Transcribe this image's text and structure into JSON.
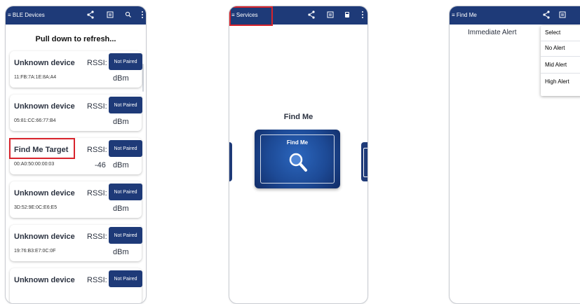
{
  "screen1": {
    "title": "BLE Devices",
    "refresh_text": "Pull down to refresh...",
    "devices": [
      {
        "name": "Unknown device",
        "rssi_label": "RSSI:",
        "pair_button": "Not Paired",
        "address": "11:FB:7A:1E:8A:A4",
        "rssi_value": "",
        "unit": "dBm"
      },
      {
        "name": "Unknown device",
        "rssi_label": "RSSI:",
        "pair_button": "Not Paired",
        "address": "05:81:CC:66:77:B4",
        "rssi_value": "",
        "unit": "dBm"
      },
      {
        "name": "Find Me Target",
        "rssi_label": "RSSI:",
        "pair_button": "Not Paired",
        "address": "00:A0:50:00:00:03",
        "rssi_value": "-46",
        "unit": "dBm"
      },
      {
        "name": "Unknown device",
        "rssi_label": "RSSI:",
        "pair_button": "Not Paired",
        "address": "3D:52:9E:0C:E6:E5",
        "rssi_value": "",
        "unit": "dBm"
      },
      {
        "name": "Unknown device",
        "rssi_label": "RSSI:",
        "pair_button": "Not Paired",
        "address": "19:76:B3:E7:0C:0F",
        "rssi_value": "",
        "unit": "dBm"
      },
      {
        "name": "Unknown device",
        "rssi_label": "RSSI:",
        "pair_button": "Not Paired",
        "address": "",
        "rssi_value": "",
        "unit": ""
      }
    ]
  },
  "screen2": {
    "title": "Services",
    "service_heading": "Find Me",
    "service_card_label": "Find Me"
  },
  "screen3": {
    "title": "Find Me",
    "alert_label": "Immediate Alert",
    "dropdown": {
      "header": "Select",
      "options": [
        "No Alert",
        "Mid Alert",
        "High Alert"
      ]
    }
  },
  "colors": {
    "primary": "#1e3a78",
    "highlight": "#d8242c",
    "card_gradient_light": "#2b66bd",
    "card_gradient_dark": "#112c66"
  },
  "icons": {
    "menu": "menu-icon",
    "share": "share-icon",
    "list": "list-icon",
    "search": "search-icon",
    "more": "more-vert-icon",
    "save": "save-icon",
    "magnifier": "magnifier-icon"
  }
}
